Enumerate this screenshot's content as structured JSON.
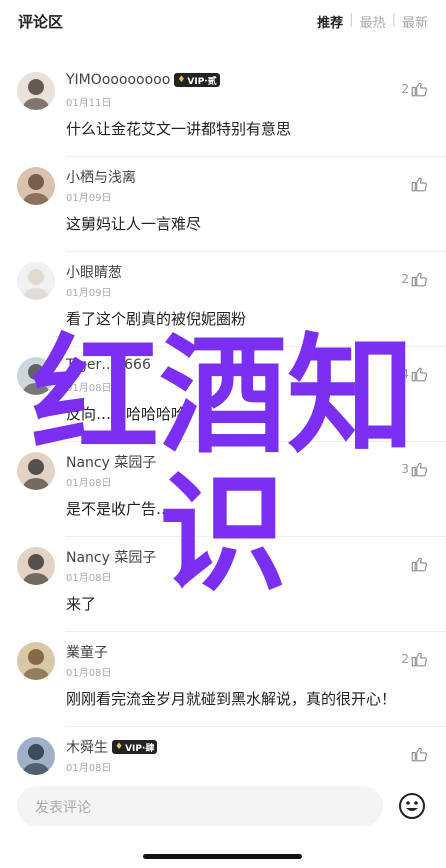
{
  "header": {
    "title": "评论区",
    "tabs": [
      {
        "label": "推荐",
        "active": true
      },
      {
        "label": "最热",
        "active": false
      },
      {
        "label": "最新",
        "active": false
      }
    ]
  },
  "comments": [
    {
      "name": "YIMOoooooooo",
      "vip": "VIP·贰",
      "date": "01月11日",
      "text": "什么让金花艾文一讲都特别有意思",
      "likes": "2"
    },
    {
      "name": "小栖与浅离",
      "vip": "",
      "date": "01月09日",
      "text": "这舅妈让人一言难尽",
      "likes": ""
    },
    {
      "name": "小眼睛葱",
      "vip": "",
      "date": "01月09日",
      "text": "看了这个剧真的被倪妮圈粉",
      "likes": "2"
    },
    {
      "name": "Tiger…u666",
      "vip": "",
      "date": "01月08日",
      "text": "反向…利哈哈哈哈",
      "likes": "4"
    },
    {
      "name": "Nancy 菜园子",
      "vip": "",
      "date": "01月08日",
      "text": "是不是收广告…",
      "likes": "3"
    },
    {
      "name": "Nancy 菜园子",
      "vip": "",
      "date": "01月08日",
      "text": "来了",
      "likes": ""
    },
    {
      "name": "業童子",
      "vip": "",
      "date": "01月08日",
      "text": "刚刚看完流金岁月就碰到黑水解说，真的很开心！",
      "likes": "2"
    },
    {
      "name": "木舜生",
      "vip": "VIP·肆",
      "date": "01月08日",
      "text": "",
      "likes": ""
    }
  ],
  "input": {
    "placeholder": "发表评论"
  },
  "watermark": {
    "line1": "红酒知",
    "line2": "识",
    "color": "#7b2ff2"
  },
  "colors": {
    "accent": "#222222",
    "muted": "#aaaaaa"
  }
}
